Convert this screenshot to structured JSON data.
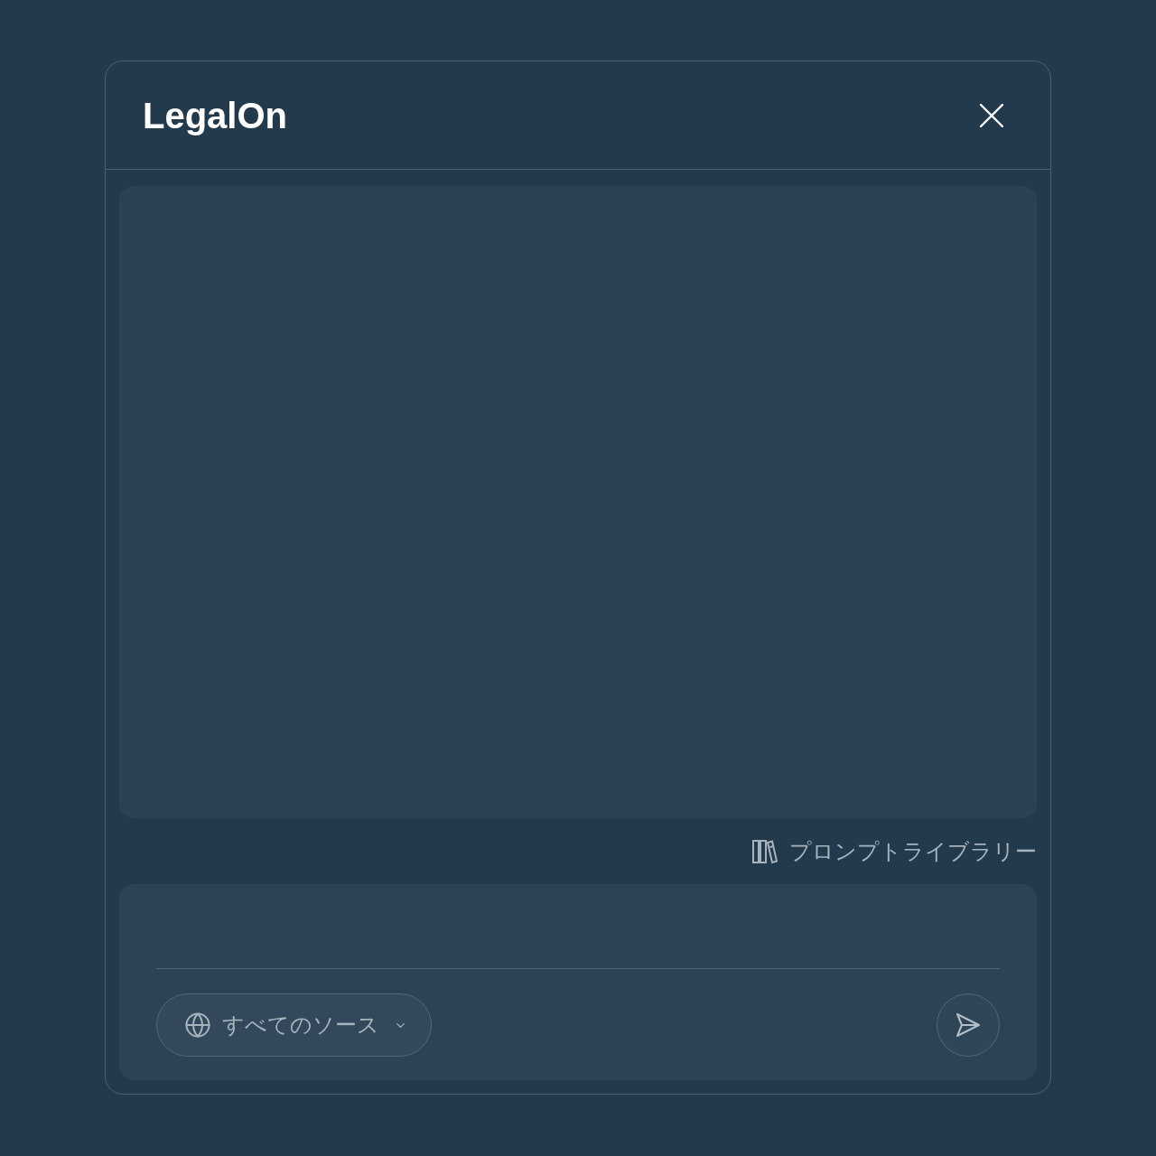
{
  "dialog": {
    "title": "LegalOn"
  },
  "prompt_library_link": {
    "label": "プロンプトライブラリー"
  },
  "composer": {
    "source_selector": {
      "label": "すべてのソース"
    }
  }
}
